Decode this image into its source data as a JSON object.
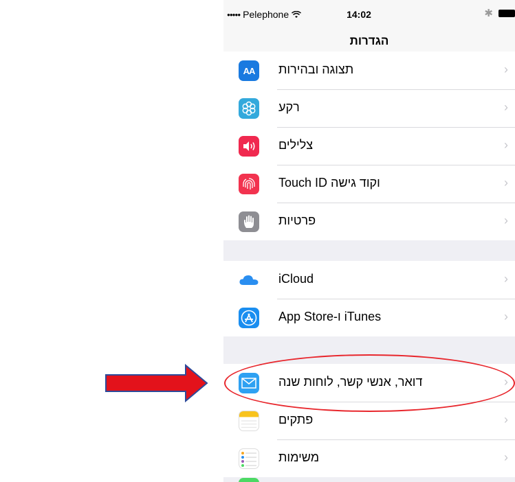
{
  "status": {
    "carrier": "Pelephone",
    "signal": "●●●●●",
    "time": "14:02"
  },
  "nav": {
    "title": "הגדרות"
  },
  "groups": [
    {
      "rows": [
        {
          "label": "תצוגה ובהירות",
          "icon": "display-brightness-icon"
        },
        {
          "label": "רקע",
          "icon": "wallpaper-icon"
        },
        {
          "label": "צלילים",
          "icon": "sounds-icon"
        },
        {
          "label": "Touch ID וקוד גישה",
          "icon": "touch-id-icon"
        },
        {
          "label": "פרטיות",
          "icon": "privacy-hand-icon"
        }
      ]
    },
    {
      "rows": [
        {
          "label": "iCloud",
          "icon": "icloud-icon"
        },
        {
          "label": "App Store-ו iTunes",
          "icon": "app-store-icon"
        }
      ]
    },
    {
      "rows": [
        {
          "label": "דואר, אנשי קשר, לוחות שנה",
          "icon": "mail-icon"
        },
        {
          "label": "פתקים",
          "icon": "notes-icon"
        },
        {
          "label": "משימות",
          "icon": "reminders-icon"
        }
      ]
    }
  ],
  "chevron": "›",
  "colors": {
    "highlight": "#e8262c",
    "arrow": "#e3121b",
    "arrowBorder": "#2d4a9a"
  }
}
